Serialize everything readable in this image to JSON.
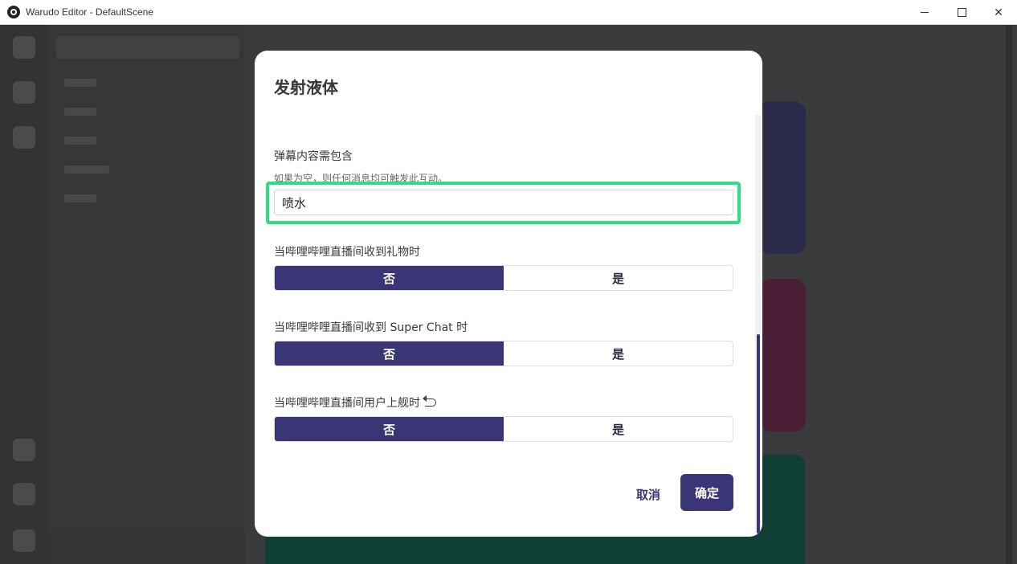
{
  "window": {
    "title": "Warudo Editor - DefaultScene",
    "minimize_glyph": "",
    "maximize_glyph": "",
    "close_glyph": "✕"
  },
  "dialog": {
    "title": "发射液体",
    "fields": {
      "danmaku": {
        "label": "弹幕内容需包含",
        "hint": "如果为空，则任何消息均可触发此互动。",
        "value": "喷水"
      },
      "gift": {
        "label": "当哔哩哔哩直播间收到礼物时",
        "options": [
          "否",
          "是"
        ],
        "selected": "否"
      },
      "superchat": {
        "label": "当哔哩哔哩直播间收到 Super Chat 时",
        "options": [
          "否",
          "是"
        ],
        "selected": "否"
      },
      "guard": {
        "label": "当哔哩哔哩直播间用户上舰时",
        "options": [
          "否",
          "是"
        ],
        "selected": "否"
      }
    },
    "cancel_label": "取消",
    "ok_label": "确定"
  },
  "colors": {
    "accent": "#3a3675",
    "highlight": "#32dc83"
  }
}
